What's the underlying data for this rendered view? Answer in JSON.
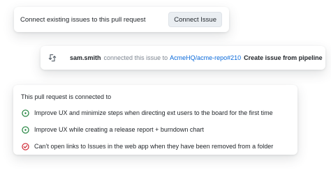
{
  "connect_card": {
    "prompt": "Connect existing issues to this pull request",
    "button_label": "Connect Issue"
  },
  "event_card": {
    "icon": "sync-icon",
    "username": "sam.smith",
    "action_text": "connected this issue to",
    "repo_ref": "AcmeHQ/acme-repo#210",
    "issue_title": "Create issue from pipeline"
  },
  "connected_card": {
    "heading": "This pull request is connected to",
    "issues": [
      {
        "title": "Improve UX and minimize steps when directing ext users to the board for the first time",
        "status": "open"
      },
      {
        "title": "Improve UX while creating a release report + burndown chart",
        "status": "open"
      },
      {
        "title": "Can’t open links to Issues in the web app when they have been removed from a folder",
        "status": "closed"
      }
    ]
  },
  "colors": {
    "open": "#1a7f37",
    "closed": "#cf222e",
    "link": "#0969da"
  }
}
